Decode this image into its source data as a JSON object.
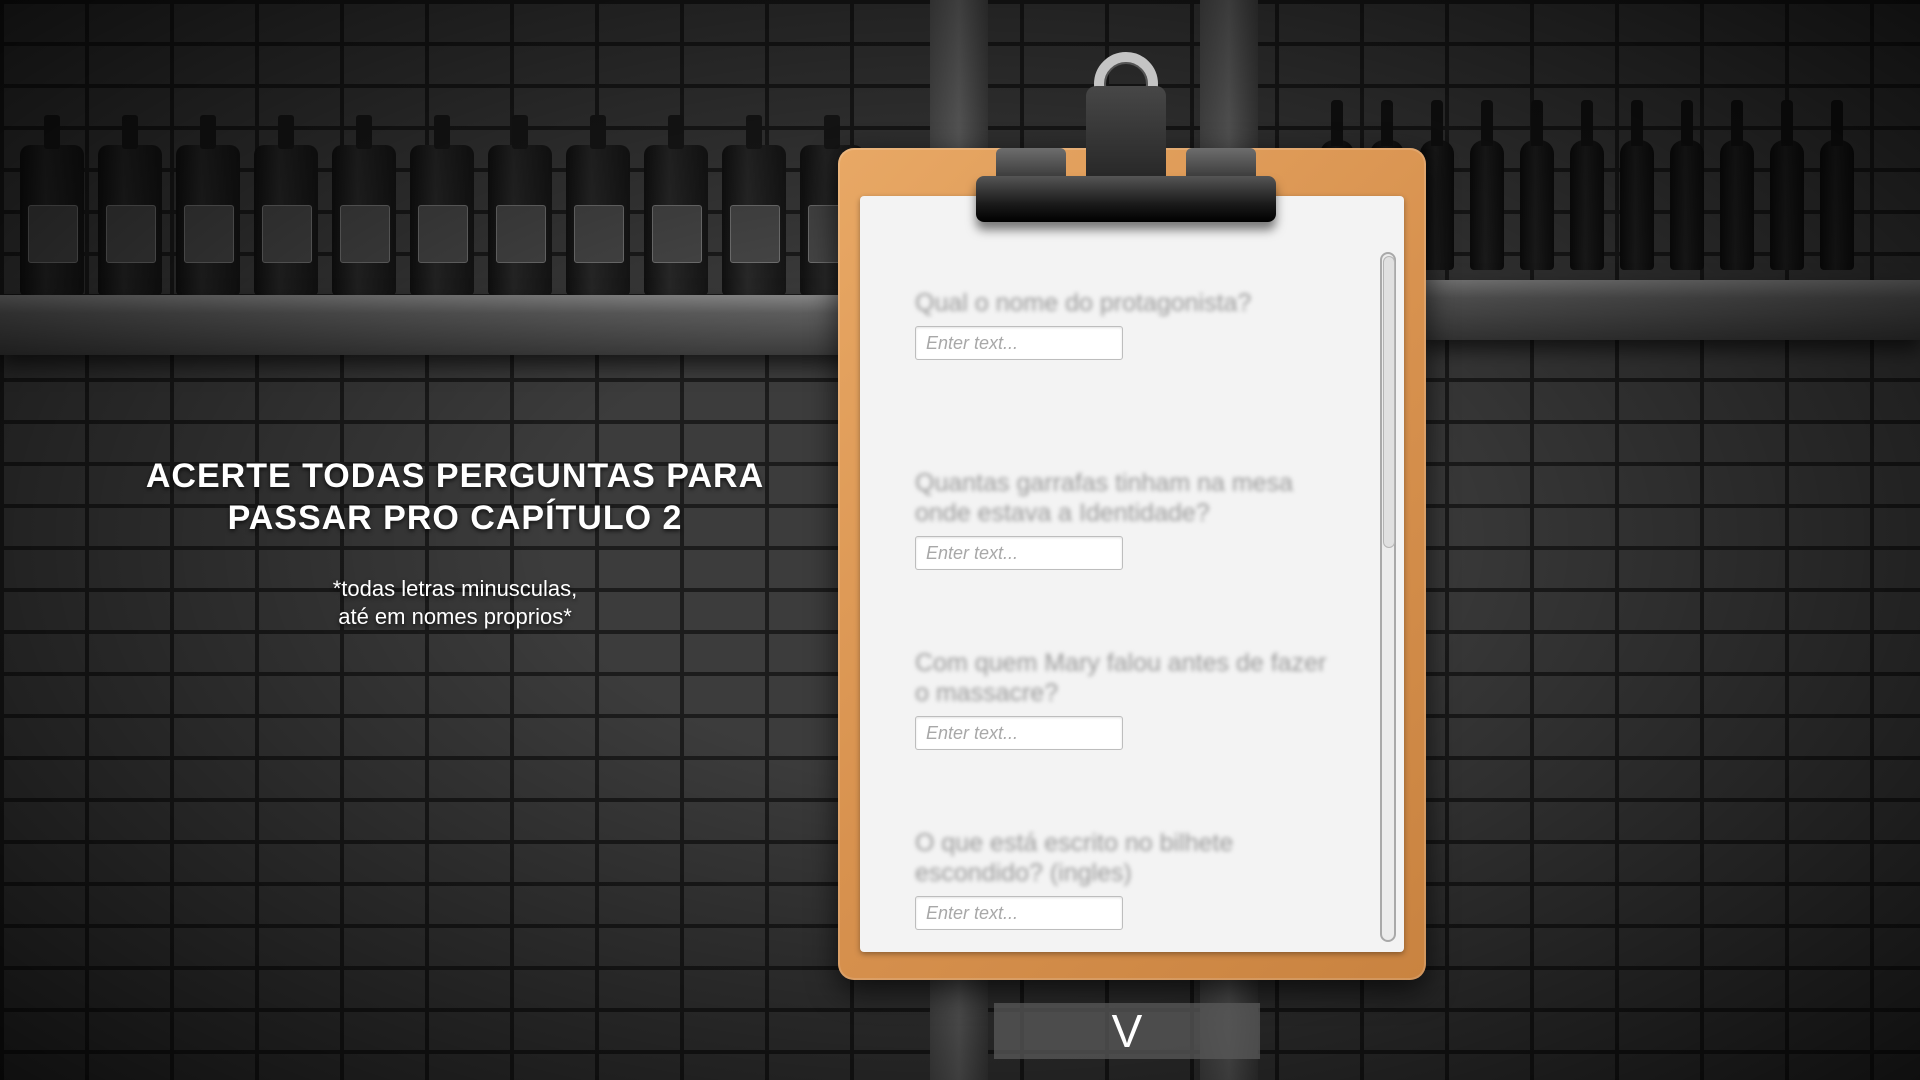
{
  "instructions": {
    "title_line1": "ACERTE TODAS PERGUNTAS PARA",
    "title_line2": "PASSAR PRO CAPÍTULO 2",
    "note_line1": "*todas letras minusculas,",
    "note_line2": "até em nomes proprios*"
  },
  "form": {
    "questions": [
      {
        "label": "Qual o nome do protagonista?",
        "placeholder": "Enter text...",
        "value": ""
      },
      {
        "label": "Quantas garrafas tinham na mesa onde estava a Identidade?",
        "placeholder": "Enter text...",
        "value": ""
      },
      {
        "label": "Com quem Mary falou antes de fazer o massacre?",
        "placeholder": "Enter text...",
        "value": ""
      },
      {
        "label": "O que está escrito no bilhete escondido? (ingles)",
        "placeholder": "Enter text...",
        "value": ""
      }
    ]
  },
  "submit": {
    "label": "V"
  },
  "colors": {
    "clipboard": "#d8924f",
    "paper": "#f3f3f3",
    "background": "#3c3c3c"
  }
}
